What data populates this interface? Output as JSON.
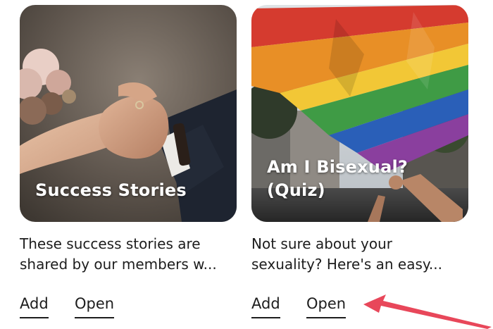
{
  "cards": [
    {
      "title": "Success Stories",
      "description": "These success stories are\nshared by our members w...",
      "add_label": "Add",
      "open_label": "Open"
    },
    {
      "title": "Am I Bisexual?\n(Quiz)",
      "description": "Not sure about your\nsexuality? Here's an easy...",
      "add_label": "Add",
      "open_label": "Open"
    }
  ],
  "annotation": {
    "arrow_color": "#e8475a",
    "arrow_target": "open-button"
  }
}
